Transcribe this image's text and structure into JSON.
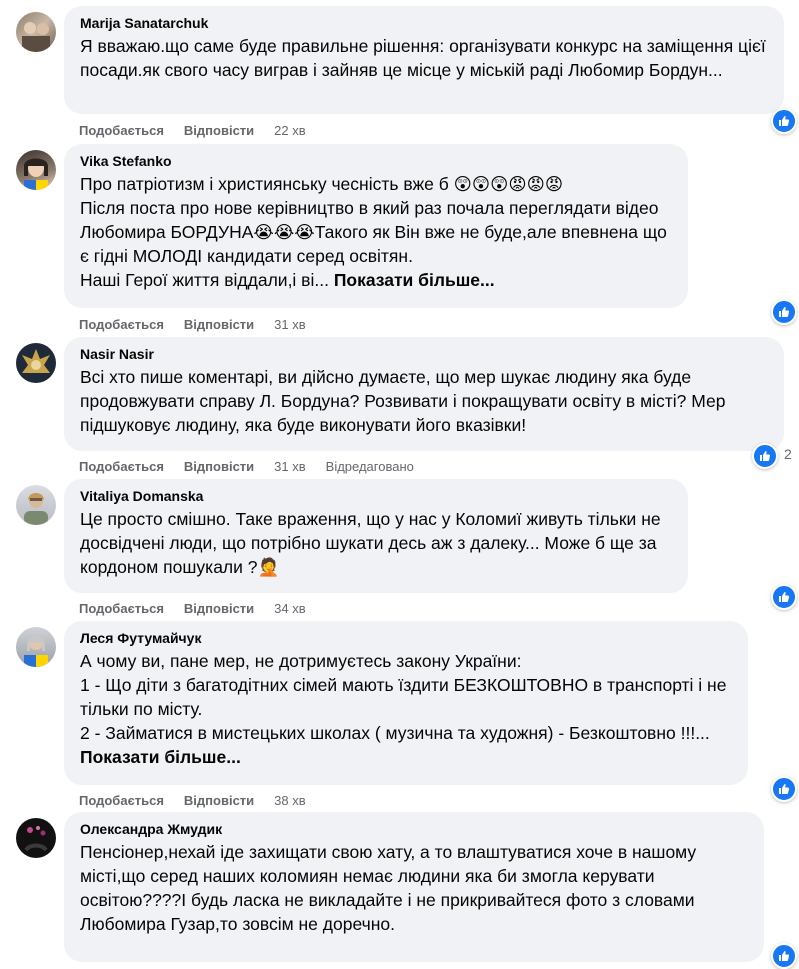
{
  "actions": {
    "like": "Подобається",
    "reply": "Відповісти"
  },
  "comments": [
    {
      "author": "Marija Sanatarchuk",
      "text": "Я вважаю.що саме буде правильне рішення: організувати конкурс на заміщення цієї посади.як свого часу виграв і зайняв це місце у міській раді Любомир Бордун...",
      "more": "",
      "time": "22 хв",
      "edited": "",
      "likes": ""
    },
    {
      "author": "Vika Stefanko",
      "text": "Про патріотизм і християнську чесність вже б 😲😲😲😡😡😡\nПісля поста про нове керівництво в який раз почала переглядати відео Любомира БОРДУНА😭😭😭Такого як Він вже не буде,але впевнена що є гідні МОЛОДІ кандидати серед освітян.\nНаші Герої життя віддали,і ві... ",
      "more": "Показати більше...",
      "time": "31 хв",
      "edited": "",
      "likes": ""
    },
    {
      "author": "Nasir Nasir",
      "text": "Всі хто пише коментарі, ви дійсно думаєте, що мер шукає людину яка буде продовжувати справу Л. Бордуна? Розвивати і покращувати освіту в місті? Мер підшуковує людину, яка буде виконувати його вказівки!",
      "more": "",
      "time": "31 хв",
      "edited": "Відредаговано",
      "likes": "2"
    },
    {
      "author": "Vitaliya Domanska",
      "text": "Це просто смішно. Таке враження, що у нас у Коломиї живуть тільки не досвідчені люди, що потрібно шукати десь аж з далеку... Може б ще за кордоном пошукали ?🤦",
      "more": "",
      "time": "34 хв",
      "edited": "",
      "likes": ""
    },
    {
      "author": "Леся Футумайчук",
      "text": "А чому ви, пане мер, не дотримуєтесь закону України:\n1 - Що діти з багатодітних сімей мають їздити БЕЗКОШТОВНО в транспорті і не тільки по місту.\n2 - Займатися в мистецьких школах ( музична та художня) - Безкоштовно !!!...\n",
      "more": "Показати більше...",
      "time": "38 хв",
      "edited": "",
      "likes": ""
    },
    {
      "author": "Олександра Жмудик",
      "text": "Пенсіонер,нехай іде захищати свою хату, а то влаштуватися хоче в нашому місті,що серед наших коломиян немає людини яка би змогла керувати освітою????І будь ласка не викладайте і не прикривайтеся фото з словами Любомира Гузар,то зовсім не доречно.",
      "more": "",
      "time": "",
      "edited": "",
      "likes": ""
    }
  ]
}
